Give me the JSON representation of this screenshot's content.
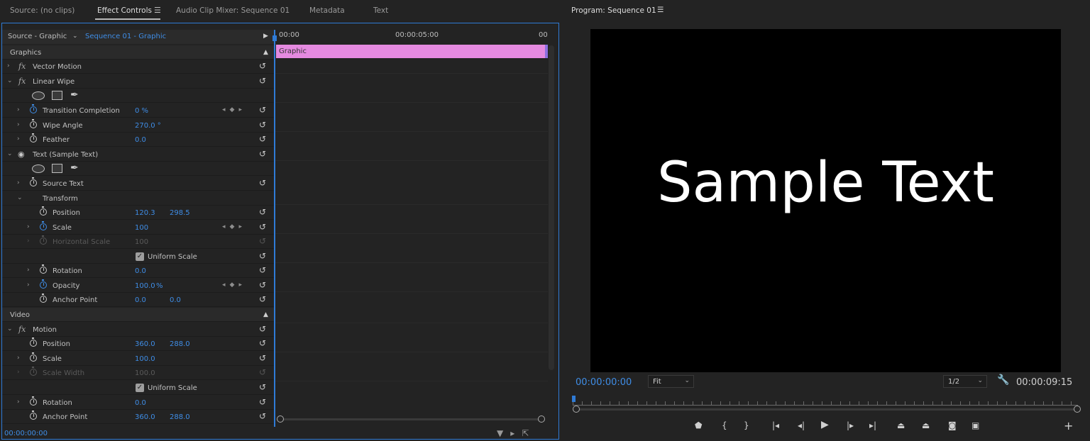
{
  "tabs": [
    {
      "label": "Source: (no clips)"
    },
    {
      "label": "Effect Controls"
    },
    {
      "label": "Audio Clip Mixer: Sequence 01"
    },
    {
      "label": "Metadata"
    },
    {
      "label": "Text"
    }
  ],
  "effect_controls": {
    "source_tab": "Source - Graphic",
    "sequence_tab": "Sequence 01 - Graphic",
    "timeline_start": "00:00",
    "timeline_mid": "00:00:05:00",
    "timeline_end": "00",
    "clip_label": "Graphic",
    "current_time": "00:00:00:00"
  },
  "sections": {
    "graphics": "Graphics",
    "video": "Video"
  },
  "rows": {
    "vector_motion": "Vector Motion",
    "linear_wipe": "Linear Wipe",
    "transition_completion": {
      "label": "Transition Completion",
      "value": "0 %"
    },
    "wipe_angle": {
      "label": "Wipe Angle",
      "value": "270.0 °"
    },
    "feather": {
      "label": "Feather",
      "value": "0.0"
    },
    "text_layer": "Text (Sample Text)",
    "source_text": "Source Text",
    "transform": "Transform",
    "position": {
      "label": "Position",
      "x": "120.3",
      "y": "298.5"
    },
    "scale": {
      "label": "Scale",
      "value": "100"
    },
    "horizontal_scale": {
      "label": "Horizontal Scale",
      "value": "100"
    },
    "uniform_scale": "Uniform Scale",
    "rotation": {
      "label": "Rotation",
      "value": "0.0"
    },
    "opacity": {
      "label": "Opacity",
      "value": "100.0",
      "unit": "%"
    },
    "anchor_point": {
      "label": "Anchor Point",
      "x": "0.0",
      "y": "0.0"
    },
    "motion": "Motion",
    "motion_position": {
      "label": "Position",
      "x": "360.0",
      "y": "288.0"
    },
    "motion_scale": {
      "label": "Scale",
      "value": "100.0"
    },
    "scale_width": {
      "label": "Scale Width",
      "value": "100.0"
    },
    "motion_uniform_scale": "Uniform Scale",
    "motion_rotation": {
      "label": "Rotation",
      "value": "0.0"
    },
    "motion_anchor_point": {
      "label": "Anchor Point",
      "x": "360.0",
      "y": "288.0"
    }
  },
  "program": {
    "title": "Program: Sequence 01",
    "overlay_text": "Sample Text",
    "timecode_current": "00:00:00:00",
    "timecode_duration": "00:00:09:15",
    "zoom": "Fit",
    "resolution": "1/2"
  },
  "colors": {
    "accent": "#3f8de6",
    "clip": "#e58ae0",
    "panel": "#232323"
  }
}
